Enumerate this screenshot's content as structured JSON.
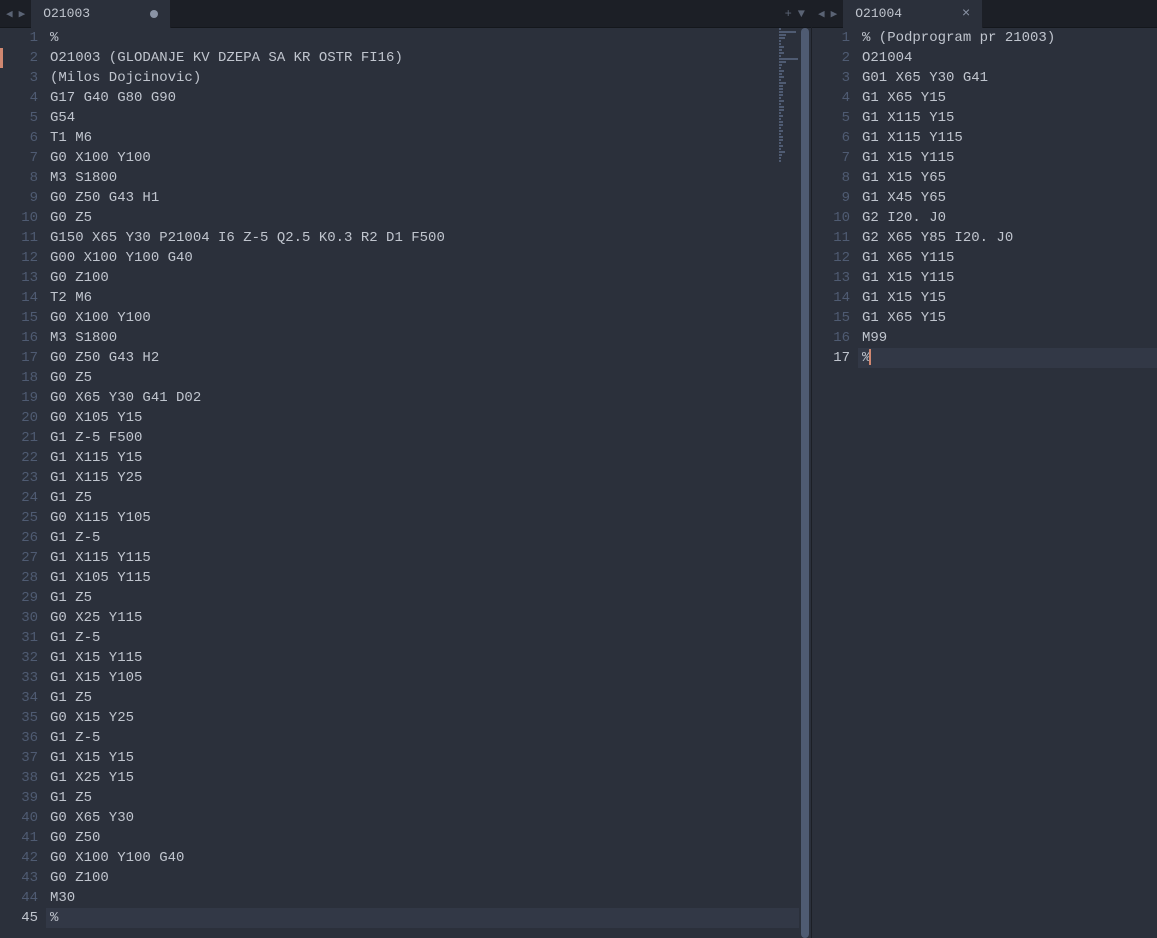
{
  "leftPane": {
    "tab": {
      "label": "O21003",
      "dirty": true
    },
    "navIcons": {
      "left": "◀",
      "right": "▶",
      "add": "+",
      "menu": "▼"
    },
    "activeLine": 45,
    "markerLine": 2,
    "lines": [
      "%",
      "O21003 (GLODANJE KV DZEPA SA KR OSTR FI16)",
      "(Milos Dojcinovic)",
      "G17 G40 G80 G90",
      "G54",
      "T1 M6",
      "G0 X100 Y100",
      "M3 S1800",
      "G0 Z50 G43 H1",
      "G0 Z5",
      "G150 X65 Y30 P21004 I6 Z-5 Q2.5 K0.3 R2 D1 F500",
      "G00 X100 Y100 G40",
      "G0 Z100",
      "T2 M6",
      "G0 X100 Y100",
      "M3 S1800",
      "G0 Z50 G43 H2",
      "G0 Z5",
      "G0 X65 Y30 G41 D02",
      "G0 X105 Y15",
      "G1 Z-5 F500",
      "G1 X115 Y15",
      "G1 X115 Y25",
      "G1 Z5",
      "G0 X115 Y105",
      "G1 Z-5",
      "G1 X115 Y115",
      "G1 X105 Y115",
      "G1 Z5",
      "G0 X25 Y115",
      "G1 Z-5",
      "G1 X15 Y115",
      "G1 X15 Y105",
      "G1 Z5",
      "G0 X15 Y25",
      "G1 Z-5",
      "G1 X15 Y15",
      "G1 X25 Y15",
      "G1 Z5",
      "G0 X65 Y30",
      "G0 Z50",
      "G0 X100 Y100 G40",
      "G0 Z100",
      "M30",
      "%"
    ]
  },
  "rightPane": {
    "tab": {
      "label": "O21004",
      "dirty": false
    },
    "navIcons": {
      "left": "◀",
      "right": "▶"
    },
    "activeLine": 17,
    "cursorAtEnd": true,
    "lines": [
      "% (Podprogram pr 21003)",
      "O21004",
      "G01 X65 Y30 G41",
      "G1 X65 Y15",
      "G1 X115 Y15",
      "G1 X115 Y115",
      "G1 X15 Y115",
      "G1 X15 Y65",
      "G1 X45 Y65",
      "G2 I20. J0",
      "G2 X65 Y85 I20. J0",
      "G1 X65 Y115",
      "G1 X15 Y115",
      "G1 X15 Y15",
      "G1 X65 Y15",
      "M99",
      "%"
    ]
  }
}
